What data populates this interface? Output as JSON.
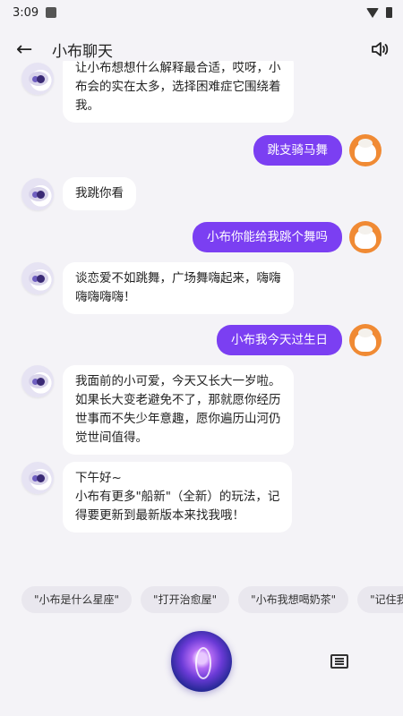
{
  "status": {
    "time": "3:09"
  },
  "header": {
    "title": "小布聊天",
    "back_icon": "←"
  },
  "messages": [
    {
      "role": "bot",
      "text": "让小布想想什么解释最合适，哎呀，小\n布会的实在太多，选择困难症它围绕着\n我。"
    },
    {
      "role": "user",
      "text": "跳支骑马舞"
    },
    {
      "role": "bot",
      "text": "我跳你看"
    },
    {
      "role": "user",
      "text": "小布你能给我跳个舞吗"
    },
    {
      "role": "bot",
      "text": "谈恋爱不如跳舞，广场舞嗨起来，嗨嗨\n嗨嗨嗨嗨！"
    },
    {
      "role": "user",
      "text": "小布我今天过生日"
    },
    {
      "role": "bot",
      "text": "我面前的小可爱，今天又长大一岁啦。\n如果长大变老避免不了，那就愿你经历\n世事而不失少年意趣，愿你遍历山河仍\n觉世间值得。"
    },
    {
      "role": "bot",
      "text": "下午好~\n小布有更多\"船新\"（全新）的玩法，记\n得要更新到最新版本来找我哦！"
    }
  ],
  "suggestions": [
    "\"小布是什么星座\"",
    "\"打开治愈屋\"",
    "\"小布我想喝奶茶\"",
    "\"记住我的"
  ],
  "colors": {
    "accent": "#7b3ff2",
    "bot_bubble": "#ffffff",
    "background": "#f4f3f7"
  }
}
